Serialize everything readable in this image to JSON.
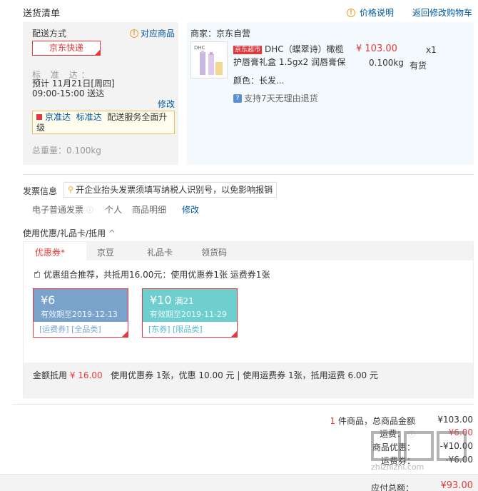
{
  "header": {
    "title": "送货清单",
    "price_note": "价格说明",
    "back_cart": "返回修改购物车"
  },
  "shipping": {
    "label": "配送方式",
    "match_goods": "对应商品",
    "method": "京东快递",
    "standard_label": "标 准 达：",
    "standard_time": "预计 11月21日[周四] 09:00-15:00 送达",
    "modify": "修改",
    "jzd_tag1": "京准达",
    "jzd_tag2": "标准达",
    "jzd_text": "配送服务全面升级",
    "total_weight": "总重量：0.100kg"
  },
  "product": {
    "merchant": "商家：京东自营",
    "badge": "京东超市",
    "title": "DHC（蝶翠诗）橄榄护唇膏礼盒 1.5gx2 润唇膏保",
    "price": "¥ 103.00",
    "qty": "x1",
    "weight": "0.100kg",
    "stock": "有货",
    "color": "颜色：长发...",
    "return_policy": "支持7天无理由退货",
    "image_label": "DHC"
  },
  "invoice": {
    "title": "发票信息",
    "tip": "开企业抬头发票须填写纳税人识别号，以免影响报销",
    "type": "电子普通发票",
    "person": "个人",
    "detail": "商品明细",
    "modify": "修改"
  },
  "coupon": {
    "title": "使用优惠/礼品卡/抵用",
    "tabs": [
      "优惠券*",
      "京豆",
      "礼品卡",
      "领货码"
    ],
    "recommend": "优惠组合推荐，共抵用16.00元：使用优惠券1张 运费券1张",
    "items": [
      {
        "amount": "¥6",
        "condition": "",
        "expiry": "有效期至2019-12-13",
        "tags": "[运费券] [全品类]"
      },
      {
        "amount": "¥10",
        "condition": "满21",
        "expiry": "有效期至2019-11-29",
        "tags": "[东券] [限品类]"
      }
    ],
    "summary_label": "金额抵用",
    "summary_amount": "¥ 16.00",
    "summary_text": "使用优惠券 1张，优惠 10.00 元 | 使用运费券 1张，抵用运费 6.00 元"
  },
  "totals": {
    "items_prefix": "1",
    "items_label": "件商品，总商品金额",
    "goods_total": "¥103.00",
    "ship_label": "运费：",
    "ship_value": "¥6.00",
    "return_label": "商品优惠：",
    "return_value": "-¥10.00",
    "ship_discount_label": "运费券：",
    "ship_discount_value": "-¥6.00",
    "pay_label": "应付总额：",
    "pay_value": "¥93.00"
  },
  "watermark": "zhizhizhi.com",
  "colors": {
    "accent": "#e4393c",
    "link": "#005aa0",
    "coupon1": "#7aa3cc",
    "coupon2": "#6fcfcf"
  }
}
